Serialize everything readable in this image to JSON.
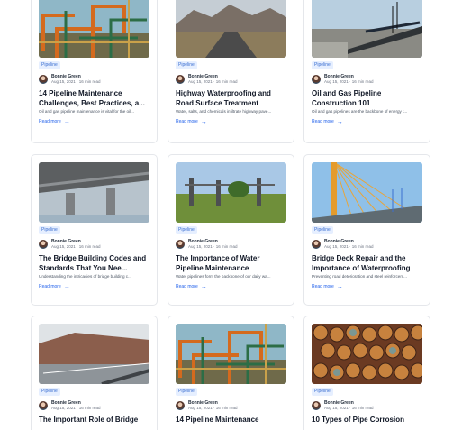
{
  "cards": [
    {
      "tag": "Pipeline",
      "author": "Bonnie Green",
      "meta": "Aug 15, 2021 · 16 min read",
      "title": "14 Pipeline Maintenance Challenges, Best Practices, a...",
      "excerpt": "Oil and gas pipeline maintenance is vital for the oil...",
      "read_more": "Read more",
      "image": "orange-pipework-refinery"
    },
    {
      "tag": "Pipeline",
      "author": "Bonnie Green",
      "meta": "Aug 15, 2021 · 16 min read",
      "title": "Highway Waterproofing and Road Surface Treatment",
      "excerpt": "Water, salts, and chemicals infiltrate highway pave...",
      "read_more": "Read more",
      "image": "mountain-highway"
    },
    {
      "tag": "Pipeline",
      "author": "Bonnie Green",
      "meta": "Aug 15, 2021 · 16 min read",
      "title": "Oil and Gas Pipeline Construction 101",
      "excerpt": "Oil and gas pipelines are the backbone of energy t...",
      "read_more": "Read more",
      "image": "pipeline-construction"
    },
    {
      "tag": "Pipeline",
      "author": "Bonnie Green",
      "meta": "Aug 15, 2021 · 16 min read",
      "title": "The Bridge Building Codes and Standards That You Nee...",
      "excerpt": "Understanding the intricacies of bridge building c...",
      "read_more": "Read more",
      "image": "bridge-underside"
    },
    {
      "tag": "Pipeline",
      "author": "Bonnie Green",
      "meta": "Aug 15, 2021 · 16 min read",
      "title": "The Importance of Water Pipeline Maintenance",
      "excerpt": "Water pipelines form the backbone of our daily wa...",
      "read_more": "Read more",
      "image": "water-pipeline-field"
    },
    {
      "tag": "Pipeline",
      "author": "Bonnie Green",
      "meta": "Aug 15, 2021 · 16 min read",
      "title": "Bridge Deck Repair and the Importance of Waterproofing",
      "excerpt": "Preventing road deterioration and steel reinforcem...",
      "read_more": "Read more",
      "image": "cable-stayed-bridge"
    },
    {
      "tag": "Pipeline",
      "author": "Bonnie Green",
      "meta": "Aug 15, 2021 · 16 min read",
      "title": "The Important Role of Bridge",
      "excerpt": "",
      "read_more": "",
      "image": "highway-bridge-hills"
    },
    {
      "tag": "Pipeline",
      "author": "Bonnie Green",
      "meta": "Aug 15, 2021 · 16 min read",
      "title": "14 Pipeline Maintenance",
      "excerpt": "",
      "read_more": "",
      "image": "orange-pipework-refinery"
    },
    {
      "tag": "Pipeline",
      "author": "Bonnie Green",
      "meta": "Aug 15, 2021 · 16 min read",
      "title": "10 Types of Pipe Corrosion",
      "excerpt": "",
      "read_more": "",
      "image": "rusted-pipe-stack"
    }
  ],
  "colors": {
    "accent": "#2563eb",
    "tag_bg": "#e6efff",
    "border": "#e5e7eb"
  }
}
